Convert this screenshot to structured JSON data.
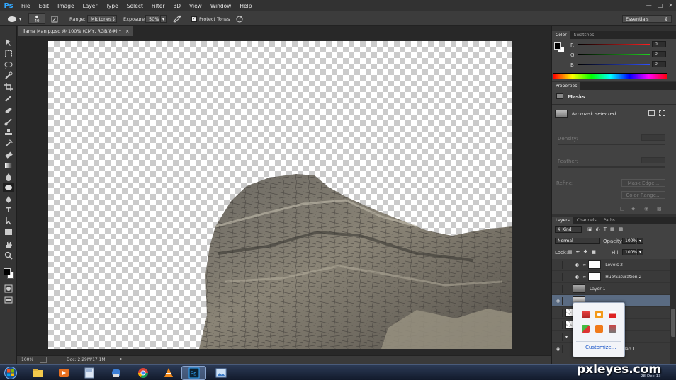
{
  "app": {
    "logo": "Ps"
  },
  "menu": [
    "File",
    "Edit",
    "Image",
    "Layer",
    "Type",
    "Select",
    "Filter",
    "3D",
    "View",
    "Window",
    "Help"
  ],
  "options": {
    "brush_size": "40",
    "range_label": "Range:",
    "range_value": "Midtones",
    "exposure_label": "Exposure:",
    "exposure_value": "50%",
    "protect_tones": "Protect Tones",
    "workspace": "Essentials"
  },
  "document": {
    "tab_title": "llama Manip.psd @ 100% (CMY, RGB/8#) *",
    "close": "×"
  },
  "status": {
    "zoom": "100%",
    "doc_info": "Doc: 2,29M/17,1M"
  },
  "color_panel": {
    "tabs": [
      "Color",
      "Swatches"
    ],
    "channels": [
      {
        "label": "R",
        "value": "0",
        "color": "#ff2020"
      },
      {
        "label": "G",
        "value": "0",
        "color": "#20d020"
      },
      {
        "label": "B",
        "value": "0",
        "color": "#3050ff"
      }
    ]
  },
  "properties": {
    "tab": "Properties",
    "title": "Masks",
    "no_mask": "No mask selected",
    "density_label": "Density:",
    "feather_label": "Feather:",
    "refine_label": "Refine:",
    "mask_edge_button": "Mask Edge...",
    "color_range_button": "Color Range..."
  },
  "layers_panel": {
    "tabs": [
      "Layers",
      "Channels",
      "Paths"
    ],
    "kind_filter": "Kind",
    "blend_mode": "Normal",
    "opacity_label": "Opacity:",
    "opacity_value": "100%",
    "lock_label": "Lock:",
    "fill_label": "Fill:",
    "fill_value": "100%",
    "layers": [
      {
        "name": "Levels 2"
      },
      {
        "name": "Hue/Saturation 2"
      },
      {
        "name": "Layer 1"
      },
      {
        "name": ""
      },
      {
        "name": ""
      },
      {
        "name": ""
      },
      {
        "name": ""
      },
      {
        "name": "Map 1"
      }
    ]
  },
  "tray_popup": {
    "customize": "Customize..."
  },
  "taskbar": {
    "date": "28-Dec-13"
  },
  "watermark": "pxleyes.com"
}
